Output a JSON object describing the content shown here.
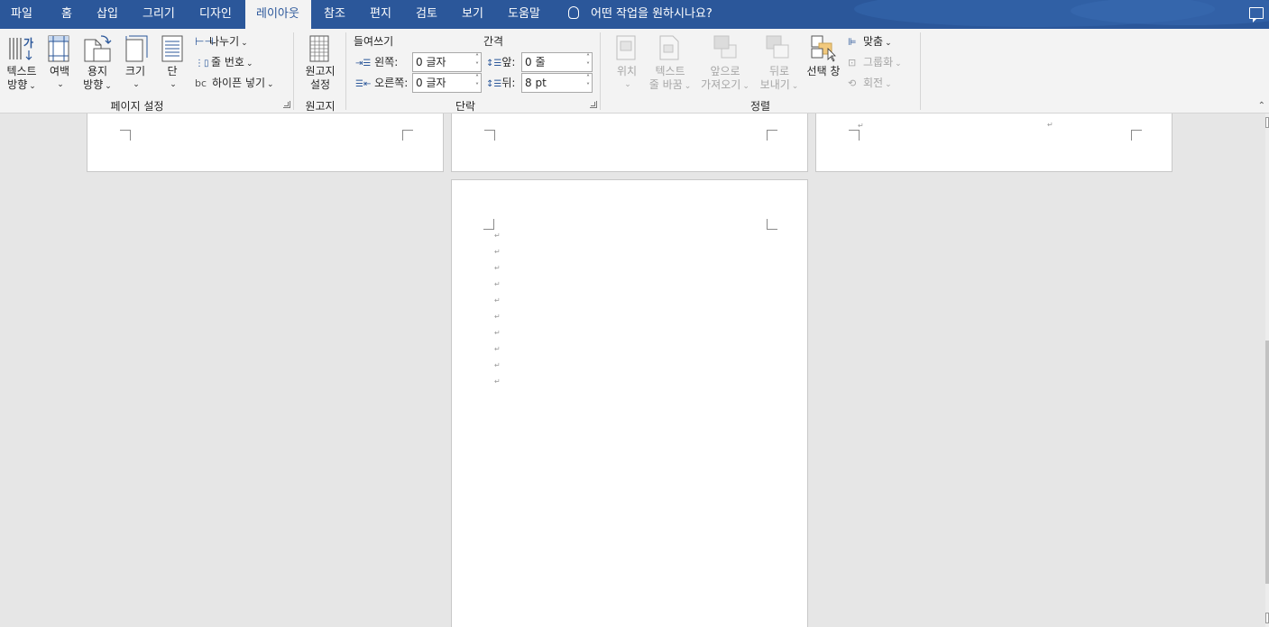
{
  "tabs": [
    "파일",
    "홈",
    "삽입",
    "그리기",
    "디자인",
    "레이아웃",
    "참조",
    "편지",
    "검토",
    "보기",
    "도움말"
  ],
  "active_tab": "레이아웃",
  "tell_me": "어떤 작업을 원하시나요?",
  "page_setup": {
    "text_direction": [
      "텍스트",
      "방향"
    ],
    "margins": "여백",
    "orientation": [
      "용지",
      "방향"
    ],
    "size": "크기",
    "columns": "단",
    "breaks": "나누기",
    "line_numbers": "줄 번호",
    "hyphenation": "하이픈 넣기",
    "group_label": "페이지 설정"
  },
  "manuscript": {
    "button": [
      "원고지",
      "설정"
    ],
    "group_label": "원고지"
  },
  "paragraph": {
    "indent_title": "들여쓰기",
    "spacing_title": "간격",
    "left_label": "왼쪽:",
    "right_label": "오른쪽:",
    "before_label": "앞:",
    "after_label": "뒤:",
    "left_value": "0 글자",
    "right_value": "0 글자",
    "before_value": "0 줄",
    "after_value": "8 pt",
    "group_label": "단락"
  },
  "arrange": {
    "position": "위치",
    "wrap_text": [
      "텍스트",
      "줄 바꿈"
    ],
    "bring_forward": [
      "앞으로",
      "가져오기"
    ],
    "send_backward": [
      "뒤로",
      "보내기"
    ],
    "selection_pane": "선택 창",
    "align": "맞춤",
    "group": "그룹화",
    "rotate": "회전",
    "group_label": "정렬"
  },
  "paragraph_mark": "↵",
  "paragraph_mark_count": 10,
  "colors": {
    "tab_bar": "#2b579a",
    "ribbon": "#f3f3f3",
    "workspace": "#e6e6e6"
  }
}
